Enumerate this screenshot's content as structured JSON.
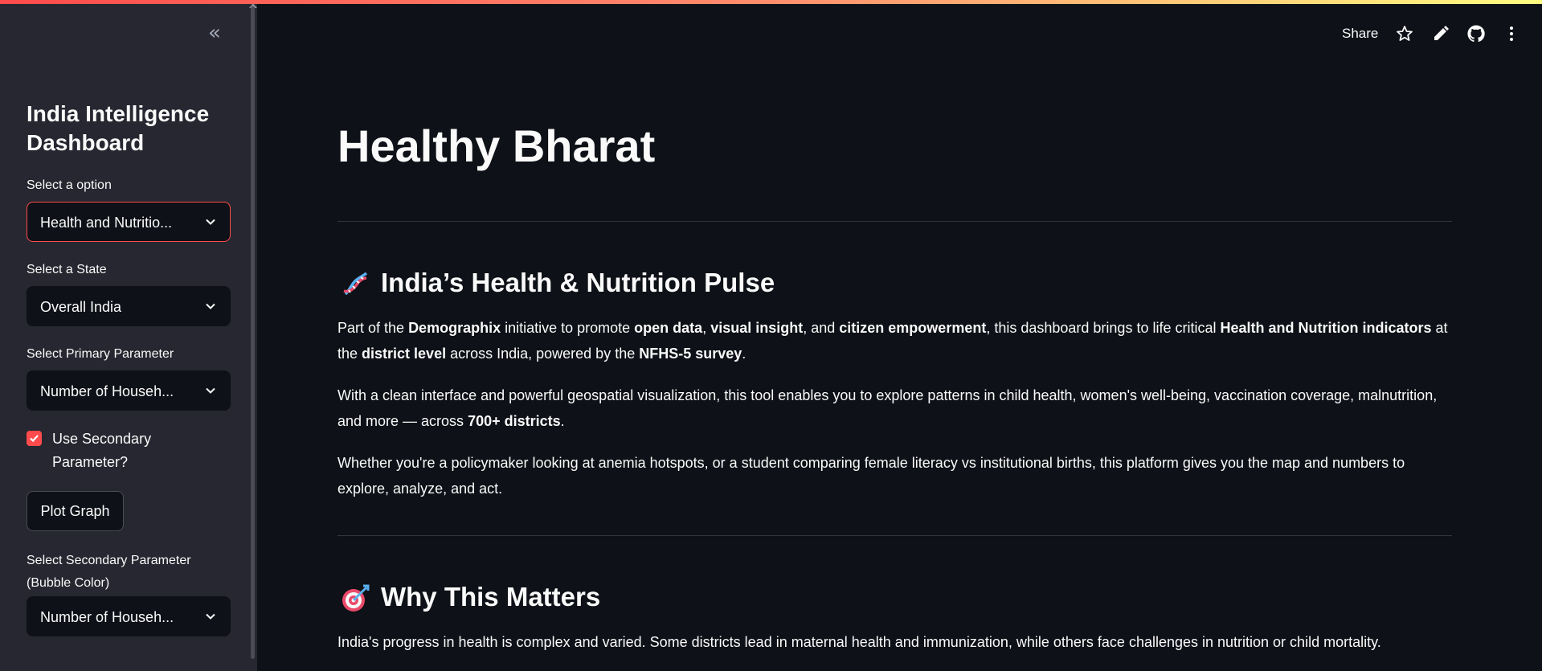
{
  "sidebar": {
    "collapse_icon": "chevron-double-left-icon",
    "title": "India Intelligence Dashboard",
    "option_label": "Select a option",
    "option_value": "Health and Nutritio...",
    "state_label": "Select a State",
    "state_value": "Overall India",
    "primary_label": "Select Primary Parameter",
    "primary_value": "Number of Househ...",
    "secondary_checkbox_label": "Use Secondary Parameter?",
    "secondary_checked": true,
    "plot_button": "Plot Graph",
    "secondary_label": "Select Secondary Parameter (Bubble Color)",
    "secondary_value": "Number of Househ..."
  },
  "toolbar": {
    "share_label": "Share",
    "icons": [
      "star-icon",
      "pencil-icon",
      "github-icon",
      "more-vertical-icon"
    ]
  },
  "main": {
    "title": "Healthy Bharat",
    "section1": {
      "emoji": "dna-icon",
      "heading": "India’s Health & Nutrition Pulse",
      "p1": {
        "t1": "Part of the ",
        "b1": "Demographix",
        "t2": " initiative to promote ",
        "b2": "open data",
        "t3": ", ",
        "b3": "visual insight",
        "t4": ", and ",
        "b4": "citizen empowerment",
        "t5": ", this dashboard brings to life critical ",
        "b5": "Health and Nutrition indicators",
        "t6": " at the ",
        "b6": "district level",
        "t7": " across India, powered by the ",
        "b7": "NFHS-5 survey",
        "t8": "."
      },
      "p2": {
        "t1": "With a clean interface and powerful geospatial visualization, this tool enables you to explore patterns in child health, women's well-being, vaccination coverage, malnutrition, and more — across ",
        "b1": "700+ districts",
        "t2": "."
      },
      "p3": "Whether you're a policymaker looking at anemia hotspots, or a student comparing female literacy vs institutional births, this platform gives you the map and numbers to explore, analyze, and act."
    },
    "section2": {
      "emoji": "target-icon",
      "heading": "Why This Matters",
      "p1": "India's progress in health is complex and varied. Some districts lead in maternal health and immunization, while others face challenges in nutrition or child mortality."
    }
  },
  "colors": {
    "accent": "#ff4b4b",
    "background": "#0e1117",
    "sidebar": "#262730"
  }
}
